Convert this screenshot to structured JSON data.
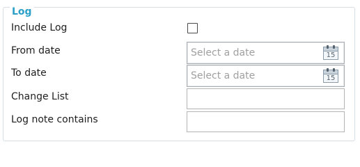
{
  "group": {
    "title": "Log"
  },
  "fields": {
    "include_log": {
      "label": "Include Log",
      "checked": false
    },
    "from_date": {
      "label": "From date",
      "placeholder": "Select a date",
      "calendar_day": "15"
    },
    "to_date": {
      "label": "To date",
      "placeholder": "Select a date",
      "calendar_day": "15"
    },
    "change_list": {
      "label": "Change List",
      "value": ""
    },
    "log_note": {
      "label": "Log note contains",
      "value": ""
    }
  },
  "colors": {
    "legend": "#2aa0c8",
    "border": "#d5dfe5",
    "placeholder": "#a0a0a0"
  }
}
